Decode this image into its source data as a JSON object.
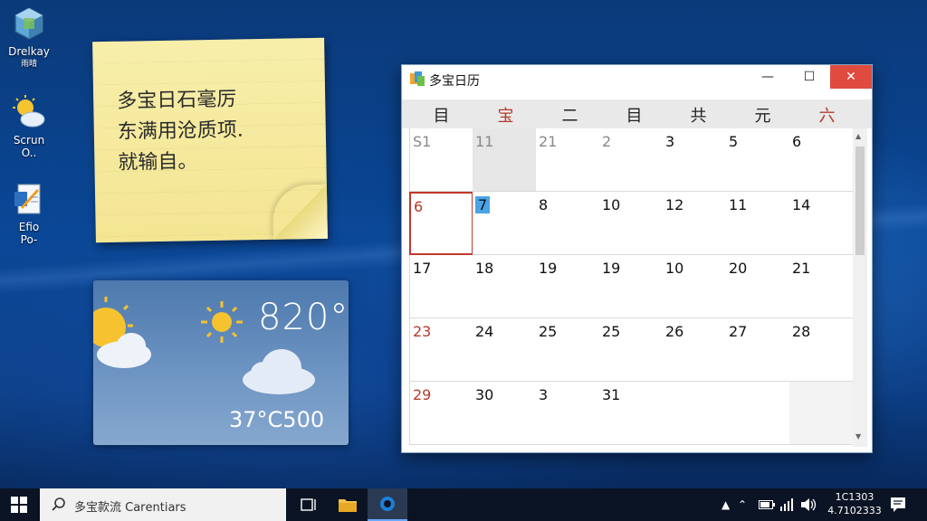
{
  "desktop": {
    "icons": [
      {
        "label_line1": "Drelkay",
        "label_line2": "雨晴"
      },
      {
        "label_line1": "Scrun",
        "label_line2": "O.."
      },
      {
        "label_line1": "Efio",
        "label_line2": "Po-"
      }
    ]
  },
  "sticky_note": {
    "lines": [
      "多宝日石毫厉",
      "东满用沧质项.",
      "就输自。"
    ]
  },
  "weather": {
    "temp_main": "820°",
    "temp_sub": "37°C500",
    "icons": [
      "partly-cloudy-icon",
      "sun-icon",
      "cloud-icon"
    ]
  },
  "calendar_window": {
    "title": "多宝日历",
    "controls": {
      "minimize": "—",
      "maximize": "☐",
      "close": "✕"
    },
    "weekdays": [
      {
        "label": "目",
        "red": false
      },
      {
        "label": "宝",
        "red": true
      },
      {
        "label": "二",
        "red": false
      },
      {
        "label": "目",
        "red": false
      },
      {
        "label": "共",
        "red": false
      },
      {
        "label": "元",
        "red": false
      },
      {
        "label": "六",
        "red": true
      }
    ],
    "weeks": [
      [
        {
          "d": "S1",
          "s": "muted"
        },
        {
          "d": "11",
          "s": "muted",
          "bg": "shaded"
        },
        {
          "d": "21",
          "s": "muted"
        },
        {
          "d": "2",
          "s": "muted"
        },
        {
          "d": "3",
          "s": ""
        },
        {
          "d": "5",
          "s": ""
        },
        {
          "d": "6",
          "s": ""
        }
      ],
      [
        {
          "d": "6",
          "s": "red",
          "sel": true
        },
        {
          "d": "7",
          "s": "hl"
        },
        {
          "d": "8",
          "s": ""
        },
        {
          "d": "10",
          "s": ""
        },
        {
          "d": "12",
          "s": ""
        },
        {
          "d": "11",
          "s": ""
        },
        {
          "d": "14",
          "s": ""
        }
      ],
      [
        {
          "d": "17",
          "s": ""
        },
        {
          "d": "18",
          "s": ""
        },
        {
          "d": "19",
          "s": ""
        },
        {
          "d": "19",
          "s": ""
        },
        {
          "d": "10",
          "s": ""
        },
        {
          "d": "20",
          "s": ""
        },
        {
          "d": "21",
          "s": ""
        }
      ],
      [
        {
          "d": "23",
          "s": "red"
        },
        {
          "d": "24",
          "s": ""
        },
        {
          "d": "25",
          "s": ""
        },
        {
          "d": "25",
          "s": ""
        },
        {
          "d": "26",
          "s": ""
        },
        {
          "d": "27",
          "s": ""
        },
        {
          "d": "28",
          "s": ""
        }
      ],
      [
        {
          "d": "29",
          "s": "red"
        },
        {
          "d": "30",
          "s": ""
        },
        {
          "d": "3",
          "s": ""
        },
        {
          "d": "31",
          "s": ""
        },
        {
          "d": "",
          "s": ""
        },
        {
          "d": "",
          "s": ""
        },
        {
          "d": "",
          "s": "",
          "bg": "grayish"
        }
      ]
    ]
  },
  "taskbar": {
    "search_text": "多宝款流 Cаrеntiаrs",
    "clock_time": "1C1303",
    "clock_date": "4.7102333",
    "colors": {
      "accent": "#6aa9ff",
      "bar": "#0b1424"
    }
  }
}
